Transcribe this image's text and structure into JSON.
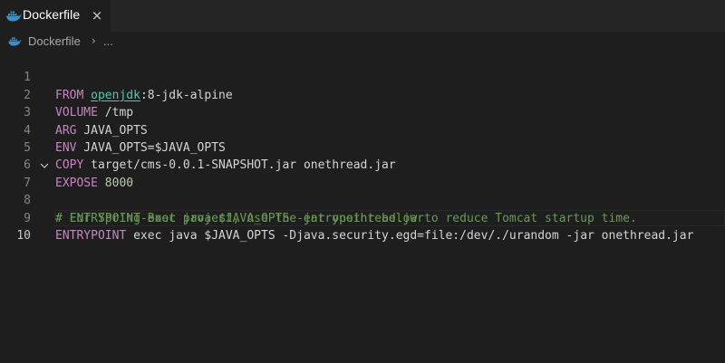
{
  "tab": {
    "label": "Dockerfile",
    "icon": "docker-whale-icon",
    "close": "×"
  },
  "breadcrumb": {
    "file": "Dockerfile",
    "separator": "›",
    "more": "..."
  },
  "colors": {
    "keyword": "#c586c0",
    "text": "#d4d4d4",
    "link": "#4ec9b0",
    "comment": "#6a9955",
    "number": "#b5cea8",
    "whale": "#3d8ec7"
  },
  "lines": [
    {
      "n": "1",
      "kw": "FROM",
      "link": "openjdk",
      "rest": ":8-jdk-alpine"
    },
    {
      "n": "2",
      "kw": "VOLUME",
      "rest": " /tmp"
    },
    {
      "n": "3",
      "kw": "ARG",
      "rest": " JAVA_OPTS"
    },
    {
      "n": "4",
      "kw": "ENV",
      "rest": " JAVA_OPTS=$JAVA_OPTS"
    },
    {
      "n": "5",
      "kw": "COPY",
      "rest": " target/cms-0.0.1-SNAPSHOT.jar onethread.jar"
    },
    {
      "n": "6",
      "kw": "EXPOSE",
      "num": " 8000"
    },
    {
      "n": "7",
      "comment": "# ENTRYPOINT exec java $JAVA_OPTS -jar onethread.jar"
    },
    {
      "n": "8",
      "comment": "# For Spring-Boot project, use the entrypoint below to reduce Tomcat startup time."
    },
    {
      "n": "9",
      "kw": "ENTRYPOINT",
      "rest": " exec java $JAVA_OPTS -Djava.security.egd=file:/dev/./urandom -jar onethread.jar"
    },
    {
      "n": "10"
    }
  ]
}
